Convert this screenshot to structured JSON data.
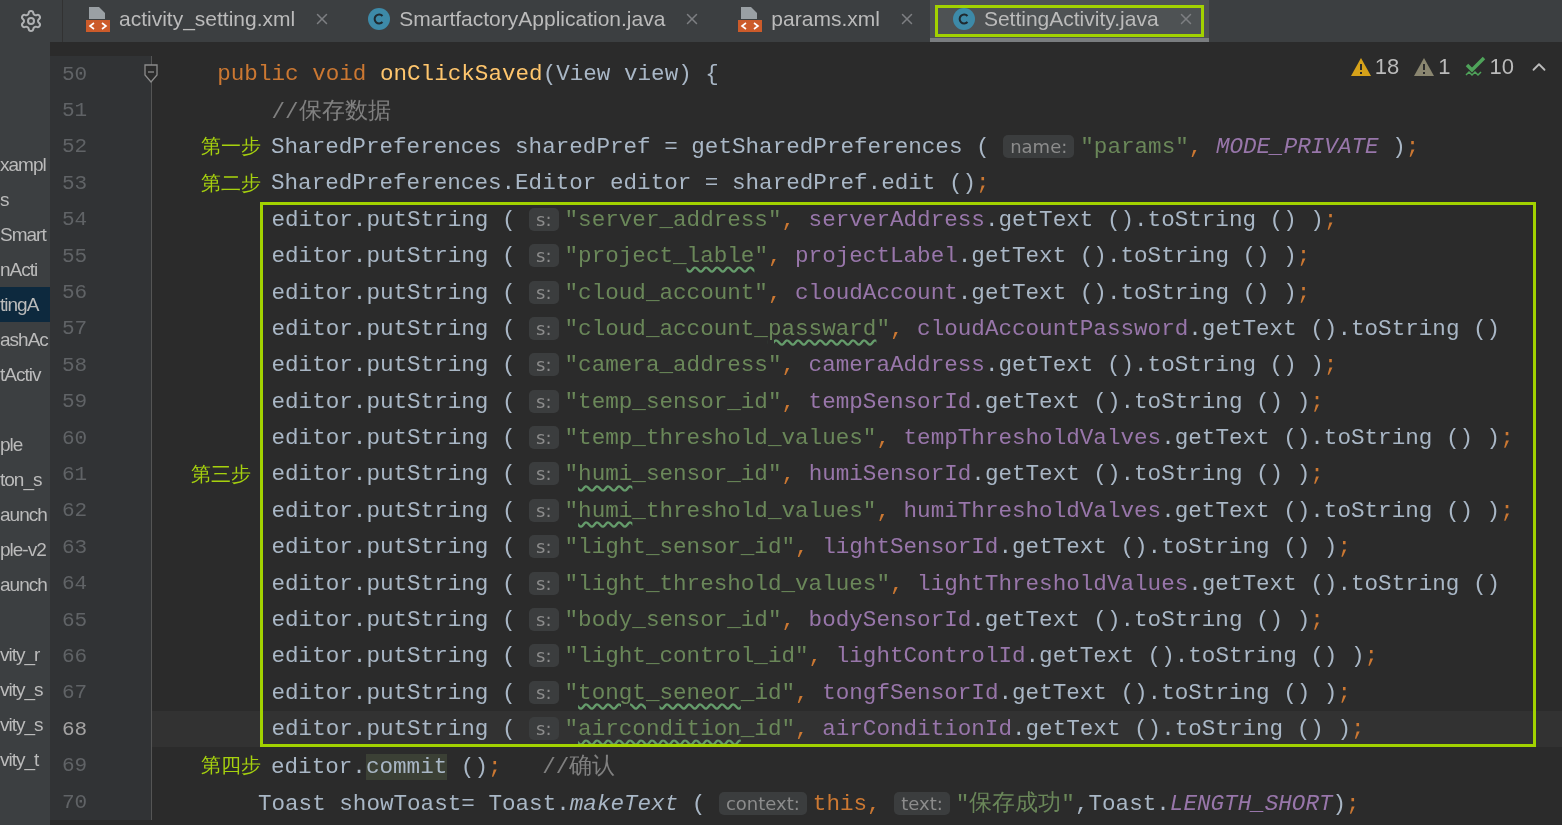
{
  "tabs": [
    {
      "kind": "xml",
      "label": "activity_setting.xml",
      "selected": false,
      "highlighted": false
    },
    {
      "kind": "java",
      "label": "SmartfactoryApplication.java",
      "selected": false,
      "highlighted": false
    },
    {
      "kind": "xml",
      "label": "params.xml",
      "selected": false,
      "highlighted": false
    },
    {
      "kind": "java",
      "label": "SettingActivity.java",
      "selected": true,
      "highlighted": true
    }
  ],
  "project_tree": {
    "groups": [
      {
        "items": [
          {
            "label": "xampl",
            "selected": false
          },
          {
            "label": "s",
            "selected": false
          },
          {
            "label": "Smart",
            "selected": false
          },
          {
            "label": "nActi",
            "selected": false
          },
          {
            "label": "tingA",
            "selected": true
          },
          {
            "label": "ashAc",
            "selected": false
          },
          {
            "label": "tActiv",
            "selected": false
          }
        ]
      },
      {
        "items": [
          {
            "label": "ple",
            "selected": false
          },
          {
            "label": "ton_s",
            "selected": false
          },
          {
            "label": "aunch",
            "selected": false
          },
          {
            "label": "ple-v2",
            "selected": false
          },
          {
            "label": "aunch",
            "selected": false
          }
        ]
      },
      {
        "items": [
          {
            "label": "vity_r",
            "selected": false
          },
          {
            "label": "vity_s",
            "selected": false
          },
          {
            "label": "vity_s",
            "selected": false
          },
          {
            "label": "vity_t",
            "selected": false
          }
        ]
      }
    ]
  },
  "inspections": [
    {
      "kind": "warning",
      "count": "18"
    },
    {
      "kind": "weak_warning",
      "count": "1"
    },
    {
      "kind": "typo",
      "count": "10"
    }
  ],
  "editor": {
    "lines": [
      {
        "kind": "fold_start",
        "number": "50",
        "current": false,
        "tokens": [
          {
            "kind": "keyword",
            "text": "    public void "
          },
          {
            "kind": "method",
            "text": "onClickSaved"
          },
          {
            "kind": "plain",
            "text": "(View view) {"
          }
        ]
      },
      {
        "kind": "line",
        "number": "51",
        "current": false,
        "tokens": [
          {
            "kind": "comment",
            "text": "        //保存数据"
          }
        ]
      },
      {
        "kind": "line",
        "number": "52",
        "current": false,
        "step": "第一步",
        "tokens": [
          {
            "kind": "plain",
            "text": "SharedPreferences sharedPref = getSharedPreferences ( "
          },
          {
            "kind": "hint",
            "text": "name:"
          },
          {
            "kind": "string",
            "text": "\"params\""
          },
          {
            "kind": "keyword",
            "text": ", "
          },
          {
            "kind": "constant",
            "text": "MODE_PRIVATE"
          },
          {
            "kind": "plain",
            "text": " )"
          },
          {
            "kind": "keyword",
            "text": ";"
          }
        ]
      },
      {
        "kind": "line",
        "number": "53",
        "current": false,
        "step": "第二步",
        "tokens": [
          {
            "kind": "plain",
            "text": "SharedPreferences.Editor editor = sharedPref.edit ()"
          },
          {
            "kind": "keyword",
            "text": ";"
          }
        ]
      },
      {
        "kind": "framed_group",
        "step": "第三步",
        "lines": [
          {
            "kind": "line",
            "number": "54",
            "current": false,
            "tokens": [
              {
                "kind": "plain",
                "text": "        editor.putString ( "
              },
              {
                "kind": "hint",
                "text": "s:"
              },
              {
                "kind": "string",
                "text": "\"server_address\""
              },
              {
                "kind": "keyword",
                "text": ", "
              },
              {
                "kind": "field",
                "text": "serverAddress"
              },
              {
                "kind": "plain",
                "text": ".getText ().toString () )"
              },
              {
                "kind": "keyword",
                "text": ";"
              }
            ]
          },
          {
            "kind": "line",
            "number": "55",
            "current": false,
            "tokens": [
              {
                "kind": "plain",
                "text": "        editor.putString ( "
              },
              {
                "kind": "hint",
                "text": "s:"
              },
              {
                "kind": "string",
                "text": "\"project_"
              },
              {
                "kind": "typo",
                "text": "lable"
              },
              {
                "kind": "string",
                "text": "\""
              },
              {
                "kind": "keyword",
                "text": ", "
              },
              {
                "kind": "field",
                "text": "projectLabel"
              },
              {
                "kind": "plain",
                "text": ".getText ().toString () )"
              },
              {
                "kind": "keyword",
                "text": ";"
              }
            ]
          },
          {
            "kind": "line",
            "number": "56",
            "current": false,
            "tokens": [
              {
                "kind": "plain",
                "text": "        editor.putString ( "
              },
              {
                "kind": "hint",
                "text": "s:"
              },
              {
                "kind": "string",
                "text": "\"cloud_account\""
              },
              {
                "kind": "keyword",
                "text": ", "
              },
              {
                "kind": "field",
                "text": "cloudAccount"
              },
              {
                "kind": "plain",
                "text": ".getText ().toString () )"
              },
              {
                "kind": "keyword",
                "text": ";"
              }
            ]
          },
          {
            "kind": "line",
            "number": "57",
            "current": false,
            "tokens": [
              {
                "kind": "plain",
                "text": "        editor.putString ( "
              },
              {
                "kind": "hint",
                "text": "s:"
              },
              {
                "kind": "string",
                "text": "\"cloud_account_"
              },
              {
                "kind": "typo",
                "text": "passward"
              },
              {
                "kind": "string",
                "text": "\""
              },
              {
                "kind": "keyword",
                "text": ", "
              },
              {
                "kind": "field",
                "text": "cloudAccountPassword"
              },
              {
                "kind": "plain",
                "text": ".getText ().toString ()"
              }
            ]
          },
          {
            "kind": "line",
            "number": "58",
            "current": false,
            "tokens": [
              {
                "kind": "plain",
                "text": "        editor.putString ( "
              },
              {
                "kind": "hint",
                "text": "s:"
              },
              {
                "kind": "string",
                "text": "\"camera_address\""
              },
              {
                "kind": "keyword",
                "text": ", "
              },
              {
                "kind": "field",
                "text": "cameraAddress"
              },
              {
                "kind": "plain",
                "text": ".getText ().toString () )"
              },
              {
                "kind": "keyword",
                "text": ";"
              }
            ]
          },
          {
            "kind": "line",
            "number": "59",
            "current": false,
            "tokens": [
              {
                "kind": "plain",
                "text": "        editor.putString ( "
              },
              {
                "kind": "hint",
                "text": "s:"
              },
              {
                "kind": "string",
                "text": "\"temp_sensor_id\""
              },
              {
                "kind": "keyword",
                "text": ", "
              },
              {
                "kind": "field",
                "text": "tempSensorId"
              },
              {
                "kind": "plain",
                "text": ".getText ().toString () )"
              },
              {
                "kind": "keyword",
                "text": ";"
              }
            ]
          },
          {
            "kind": "line",
            "number": "60",
            "current": false,
            "tokens": [
              {
                "kind": "plain",
                "text": "        editor.putString ( "
              },
              {
                "kind": "hint",
                "text": "s:"
              },
              {
                "kind": "string",
                "text": "\"temp_threshold_values\""
              },
              {
                "kind": "keyword",
                "text": ", "
              },
              {
                "kind": "field",
                "text": "tempThresholdValves"
              },
              {
                "kind": "plain",
                "text": ".getText ().toString () )"
              },
              {
                "kind": "keyword",
                "text": ";"
              }
            ]
          },
          {
            "kind": "line",
            "number": "61",
            "current": false,
            "tokens": [
              {
                "kind": "plain",
                "text": "        editor.putString ( "
              },
              {
                "kind": "hint",
                "text": "s:"
              },
              {
                "kind": "string",
                "text": "\""
              },
              {
                "kind": "typo",
                "text": "humi"
              },
              {
                "kind": "string",
                "text": "_sensor_id\""
              },
              {
                "kind": "keyword",
                "text": ", "
              },
              {
                "kind": "field",
                "text": "humiSensorId"
              },
              {
                "kind": "plain",
                "text": ".getText ().toString () )"
              },
              {
                "kind": "keyword",
                "text": ";"
              }
            ]
          },
          {
            "kind": "line",
            "number": "62",
            "current": false,
            "tokens": [
              {
                "kind": "plain",
                "text": "        editor.putString ( "
              },
              {
                "kind": "hint",
                "text": "s:"
              },
              {
                "kind": "string",
                "text": "\""
              },
              {
                "kind": "typo",
                "text": "humi"
              },
              {
                "kind": "string",
                "text": "_threshold_values\""
              },
              {
                "kind": "keyword",
                "text": ", "
              },
              {
                "kind": "field",
                "text": "humiThresholdValves"
              },
              {
                "kind": "plain",
                "text": ".getText ().toString () )"
              },
              {
                "kind": "keyword",
                "text": ";"
              }
            ]
          },
          {
            "kind": "line",
            "number": "63",
            "current": false,
            "tokens": [
              {
                "kind": "plain",
                "text": "        editor.putString ( "
              },
              {
                "kind": "hint",
                "text": "s:"
              },
              {
                "kind": "string",
                "text": "\"light_sensor_id\""
              },
              {
                "kind": "keyword",
                "text": ", "
              },
              {
                "kind": "field",
                "text": "lightSensorId"
              },
              {
                "kind": "plain",
                "text": ".getText ().toString () )"
              },
              {
                "kind": "keyword",
                "text": ";"
              }
            ]
          },
          {
            "kind": "line",
            "number": "64",
            "current": false,
            "tokens": [
              {
                "kind": "plain",
                "text": "        editor.putString ( "
              },
              {
                "kind": "hint",
                "text": "s:"
              },
              {
                "kind": "string",
                "text": "\"light_threshold_values\""
              },
              {
                "kind": "keyword",
                "text": ", "
              },
              {
                "kind": "field",
                "text": "lightThresholdValues"
              },
              {
                "kind": "plain",
                "text": ".getText ().toString ()"
              }
            ]
          },
          {
            "kind": "line",
            "number": "65",
            "current": false,
            "tokens": [
              {
                "kind": "plain",
                "text": "        editor.putString ( "
              },
              {
                "kind": "hint",
                "text": "s:"
              },
              {
                "kind": "string",
                "text": "\"body_sensor_id\""
              },
              {
                "kind": "keyword",
                "text": ", "
              },
              {
                "kind": "field",
                "text": "bodySensorId"
              },
              {
                "kind": "plain",
                "text": ".getText ().toString () )"
              },
              {
                "kind": "keyword",
                "text": ";"
              }
            ]
          },
          {
            "kind": "line",
            "number": "66",
            "current": false,
            "tokens": [
              {
                "kind": "plain",
                "text": "        editor.putString ( "
              },
              {
                "kind": "hint",
                "text": "s:"
              },
              {
                "kind": "string",
                "text": "\"light_control_id\""
              },
              {
                "kind": "keyword",
                "text": ", "
              },
              {
                "kind": "field",
                "text": "lightControlId"
              },
              {
                "kind": "plain",
                "text": ".getText ().toString () )"
              },
              {
                "kind": "keyword",
                "text": ";"
              }
            ]
          },
          {
            "kind": "line",
            "number": "67",
            "current": false,
            "tokens": [
              {
                "kind": "plain",
                "text": "        editor.putString ( "
              },
              {
                "kind": "hint",
                "text": "s:"
              },
              {
                "kind": "string",
                "text": "\""
              },
              {
                "kind": "typo",
                "text": "tongt"
              },
              {
                "kind": "string",
                "text": "_"
              },
              {
                "kind": "typo",
                "text": "seneor"
              },
              {
                "kind": "string",
                "text": "_id\""
              },
              {
                "kind": "keyword",
                "text": ", "
              },
              {
                "kind": "field",
                "text": "tongfSensorId"
              },
              {
                "kind": "plain",
                "text": ".getText ().toString () )"
              },
              {
                "kind": "keyword",
                "text": ";"
              }
            ]
          },
          {
            "kind": "line",
            "number": "68",
            "current": true,
            "tokens": [
              {
                "kind": "plain",
                "text": "        editor.putString ( "
              },
              {
                "kind": "hint",
                "text": "s:"
              },
              {
                "kind": "string",
                "text": "\""
              },
              {
                "kind": "typo",
                "text": "aircondition"
              },
              {
                "kind": "string",
                "text": "_id\""
              },
              {
                "kind": "keyword",
                "text": ", "
              },
              {
                "kind": "field",
                "text": "airConditionId"
              },
              {
                "kind": "plain",
                "text": ".getText ().toString () )"
              },
              {
                "kind": "keyword",
                "text": ";"
              }
            ]
          }
        ]
      },
      {
        "kind": "line",
        "number": "69",
        "current": false,
        "step": "第四步",
        "tokens": [
          {
            "kind": "plain",
            "text": "editor."
          },
          {
            "kind": "usage",
            "text": "commit"
          },
          {
            "kind": "plain",
            "text": " ()"
          },
          {
            "kind": "keyword",
            "text": ";"
          },
          {
            "kind": "comment",
            "text": "   //确认"
          }
        ]
      },
      {
        "kind": "line",
        "number": "70",
        "current": false,
        "tokens": [
          {
            "kind": "plain",
            "text": "       Toast showToast= Toast."
          },
          {
            "kind": "static_call",
            "text": "makeText"
          },
          {
            "kind": "plain",
            "text": " ( "
          },
          {
            "kind": "hint",
            "text": "context:"
          },
          {
            "kind": "keyword",
            "text": "this"
          },
          {
            "kind": "keyword",
            "text": ", "
          },
          {
            "kind": "hint",
            "text": "text:"
          },
          {
            "kind": "string",
            "text": "\"保存成功\""
          },
          {
            "kind": "plain",
            "text": ",Toast."
          },
          {
            "kind": "constant",
            "text": "LENGTH_SHORT"
          },
          {
            "kind": "plain",
            "text": ")"
          },
          {
            "kind": "keyword",
            "text": ";"
          }
        ]
      }
    ]
  }
}
